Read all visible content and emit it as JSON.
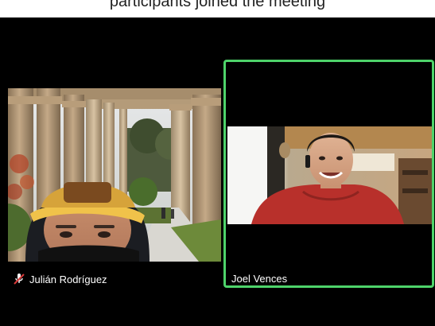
{
  "banner": {
    "text": "participants joined the meeting"
  },
  "participants": [
    {
      "name": "Julián Rodríguez",
      "muted": true,
      "active_speaker": false
    },
    {
      "name": "Joel Vences",
      "muted": false,
      "active_speaker": true
    }
  ],
  "colors": {
    "background": "#000000",
    "active_speaker_border": "#4ed36a",
    "name_text": "#ffffff",
    "mute_icon": "#d93a3a"
  },
  "icons": {
    "mute": "microphone-muted-icon"
  }
}
